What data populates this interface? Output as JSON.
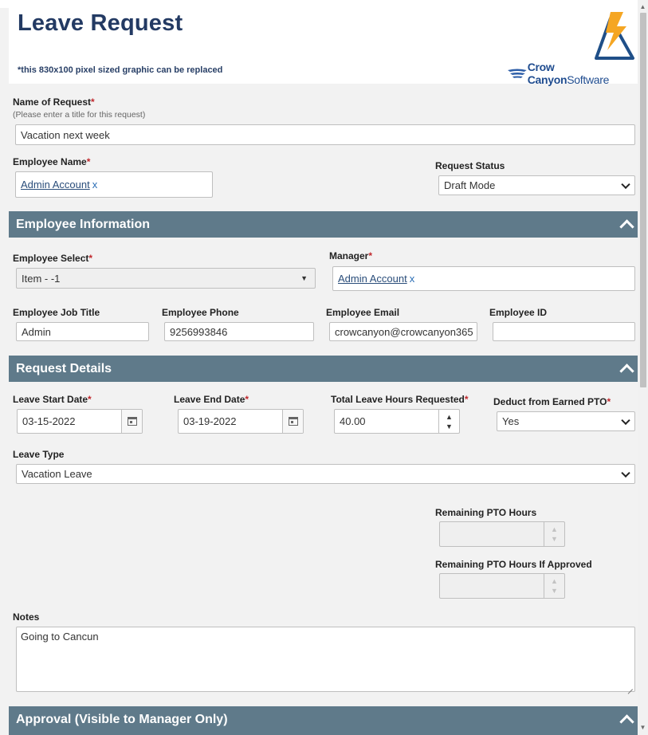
{
  "header": {
    "title": "Leave Request",
    "note": "*this 830x100 pixel sized graphic can be replaced",
    "brand_bold": "Crow Canyon",
    "brand_light": "Software"
  },
  "form": {
    "request_name": {
      "label": "Name of Request",
      "hint": "(Please enter a title for this request)",
      "value": "Vacation next week"
    },
    "employee_name": {
      "label": "Employee Name",
      "value": "Admin Account",
      "remove": "x"
    },
    "request_status": {
      "label": "Request Status",
      "value": "Draft Mode"
    }
  },
  "sections": {
    "employee_info": "Employee Information",
    "request_details": "Request Details",
    "approval": "Approval (Visible to Manager Only)"
  },
  "employee_info": {
    "employee_select": {
      "label": "Employee Select",
      "value": "Item - -1"
    },
    "manager": {
      "label": "Manager",
      "value": "Admin Account",
      "remove": "x"
    },
    "job_title": {
      "label": "Employee Job Title",
      "value": "Admin"
    },
    "phone": {
      "label": "Employee Phone",
      "value": "9256993846"
    },
    "email": {
      "label": "Employee Email",
      "value": "crowcanyon@crowcanyon365"
    },
    "employee_id": {
      "label": "Employee ID",
      "value": ""
    }
  },
  "request_details": {
    "start_date": {
      "label": "Leave Start Date",
      "value": "03-15-2022"
    },
    "end_date": {
      "label": "Leave End Date",
      "value": "03-19-2022"
    },
    "total_hours": {
      "label": "Total Leave Hours Requested",
      "value": "40.00"
    },
    "deduct_pto": {
      "label": "Deduct from Earned PTO",
      "value": "Yes"
    },
    "leave_type": {
      "label": "Leave Type",
      "value": "Vacation Leave"
    },
    "remaining_pto": {
      "label": "Remaining PTO Hours",
      "value": ""
    },
    "remaining_pto_if_approved": {
      "label": "Remaining PTO Hours If Approved",
      "value": ""
    },
    "notes": {
      "label": "Notes",
      "value": "Going to Cancun"
    }
  },
  "required_mark": "*",
  "colors": {
    "section_bar": "#5f7a8a",
    "title": "#233a63",
    "required": "#c0282d",
    "accent_orange": "#f5a623"
  }
}
